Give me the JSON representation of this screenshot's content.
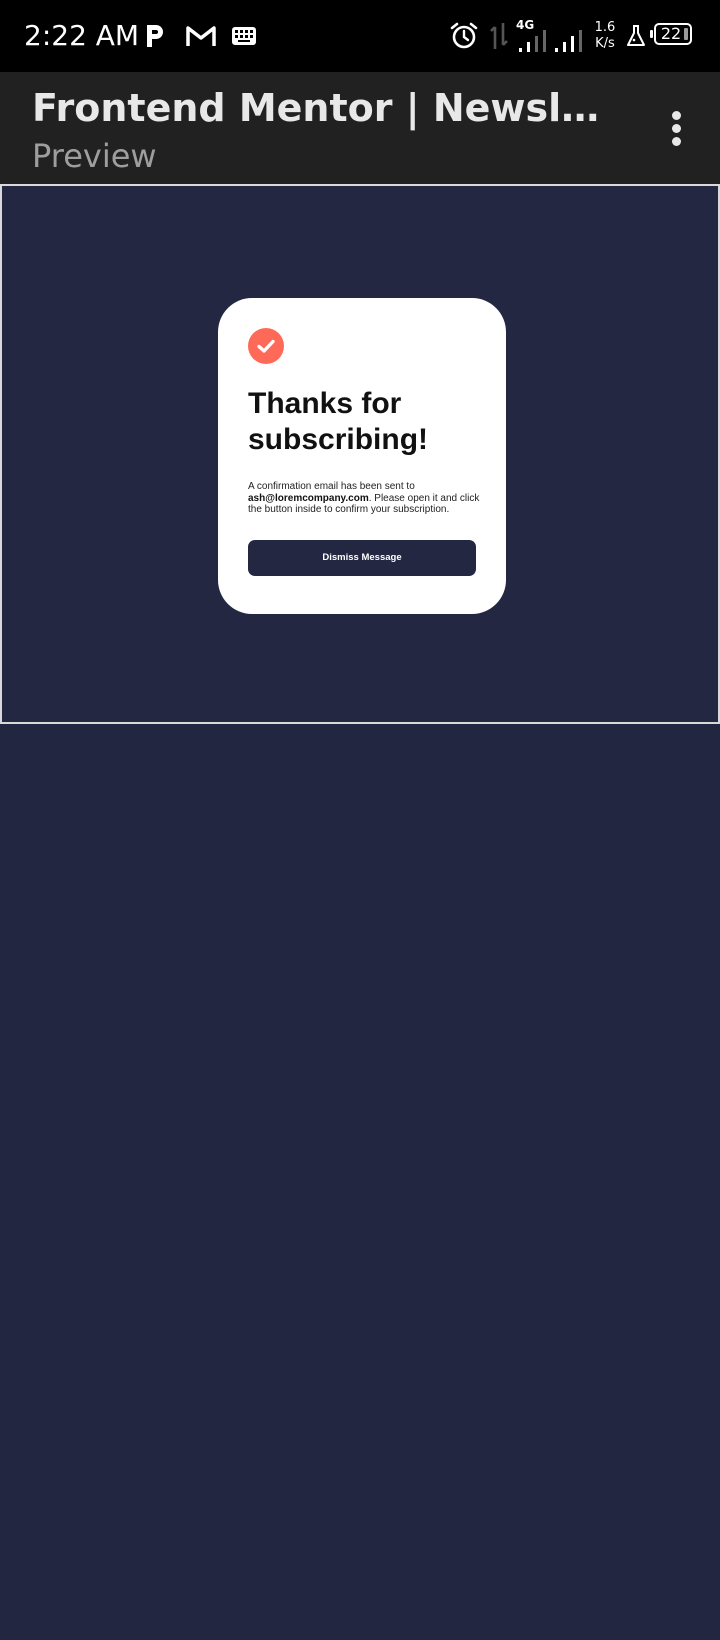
{
  "status_bar": {
    "time": "2:22 AM",
    "network_type": "4G",
    "net_speed_value": "1.6",
    "net_speed_unit": "K/s",
    "battery_level": "22",
    "icons": [
      "p-icon",
      "gmail-icon",
      "keyboard-icon",
      "alarm-icon",
      "data-arrows-icon",
      "signal-icon",
      "signal-icon",
      "lab-flask-icon",
      "battery-icon"
    ]
  },
  "app_bar": {
    "title": "Frontend Mentor | Newsletter sign-up form",
    "subtitle": "Preview",
    "menu_icon": "more-vert-icon"
  },
  "card": {
    "icon": "check-circle-icon",
    "title": "Thanks for subscribing!",
    "body_prefix": "A confirmation email has been sent to ",
    "email": "ash@loremcompany.com",
    "body_suffix": ". Please open it and click the button inside to confirm your subscription.",
    "button_label": "Dismiss Message"
  },
  "colors": {
    "page_background": "#232641",
    "status_bar": "#000000",
    "app_bar": "#212121",
    "card": "#ffffff",
    "accent": "#ff6a58",
    "button": "#242742"
  }
}
